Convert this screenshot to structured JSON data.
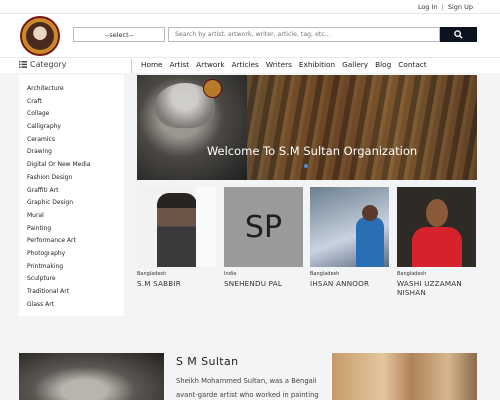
{
  "topbar": {
    "login": "Log In",
    "separator": "|",
    "signup": "Sign Up"
  },
  "header": {
    "select_value": "--select--",
    "search_placeholder": "Search by artist, artwork, writer, article, tag, etc..."
  },
  "category_label": "Category",
  "nav": [
    "Home",
    "Artist",
    "Artwork",
    "Articles",
    "Writers",
    "Exhibition",
    "Gallery",
    "Blog",
    "Contact"
  ],
  "categories": [
    "Architecture",
    "Craft",
    "Collage",
    "Calligraphy",
    "Ceramics",
    "Drawing",
    "Digital Or New Media",
    "Fashion Design",
    "Graffiti Art",
    "Graphic Design",
    "Mural",
    "Painting",
    "Performance Art",
    "Photography",
    "Printmaking",
    "Sculpture",
    "Traditional Art",
    "Glass Art"
  ],
  "hero": {
    "title": "Welcome To S.M Sultan Organization"
  },
  "artists": [
    {
      "country": "Bangladesh",
      "name": "S.M SABBIR"
    },
    {
      "country": "India",
      "name": "SNEHENDU PAL",
      "initials": "SP"
    },
    {
      "country": "Bangladesh",
      "name": "IHSAN ANNOOR"
    },
    {
      "country": "Bangladesh",
      "name": "WASHI UZZAMAN NISHAN"
    }
  ],
  "about": {
    "title": "S M Sultan",
    "text": "Sheikh Mohammed Sultan, was a Bengali avant-garde artist who worked in painting and"
  },
  "colors": {
    "accent": "#0b1220",
    "slider_dot": "#4a8ed8"
  },
  "icons": {
    "search": "search-icon",
    "category": "list-icon"
  }
}
